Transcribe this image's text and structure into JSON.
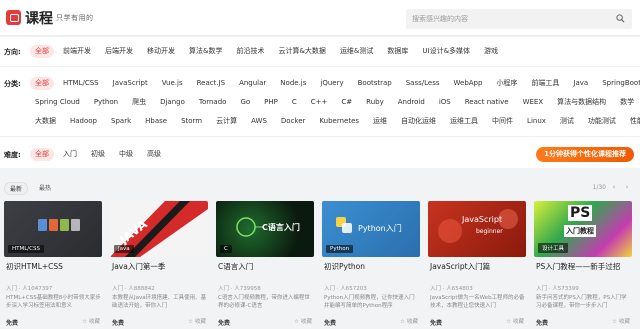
{
  "header": {
    "brand": "课程",
    "slogan": "只学有用的",
    "search_placeholder": "搜索感兴趣的内容"
  },
  "filters": {
    "direction": {
      "label": "方向:",
      "options": [
        "全部",
        "前端开发",
        "后端开发",
        "移动开发",
        "算法&数学",
        "前沿技术",
        "云计算&大数据",
        "运维&测试",
        "数据库",
        "UI设计&多媒体",
        "游戏"
      ]
    },
    "category": {
      "label": "分类:",
      "row1": [
        "全部",
        "HTML/CSS",
        "JavaScript",
        "Vue.js",
        "React.JS",
        "Angular",
        "Node.js",
        "jQuery",
        "Bootstrap",
        "Sass/Less",
        "WebApp",
        "小程序",
        "前端工具",
        "Java",
        "SpringBoot"
      ],
      "row2": [
        "Spring Cloud",
        "Python",
        "爬虫",
        "Django",
        "Tornado",
        "Go",
        "PHP",
        "C",
        "C++",
        "C#",
        "Ruby",
        "Android",
        "iOS",
        "React native",
        "WEEX",
        "算法与数据结构",
        "数学"
      ],
      "row3": [
        "大数据",
        "Hadoop",
        "Spark",
        "Hbase",
        "Storm",
        "云计算",
        "AWS",
        "Docker",
        "Kubernetes",
        "运维",
        "自动化运维",
        "运维工具",
        "中间件",
        "Linux",
        "测试",
        "功能测试",
        "性能测试"
      ]
    },
    "difficulty": {
      "label": "难度:",
      "options": [
        "全部",
        "入门",
        "初级",
        "中级",
        "高级"
      ]
    },
    "cta": "1分钟获得个性化课程推荐"
  },
  "sort": {
    "tabs": [
      "最新",
      "最热"
    ],
    "pager": "1/30",
    "prev": "‹",
    "next": "›"
  },
  "cards": [
    {
      "title": "初识HTML+CSS",
      "level": "入门",
      "learners": "人1047397",
      "desc": "HTML+CSS基础教程8小时带领大家步步深入学习标签用法和意义",
      "price": "免费",
      "fav": "收藏",
      "tag": "HTML/CSS",
      "thumb_text": ""
    },
    {
      "title": "Java入门第一季",
      "level": "入门",
      "learners": "人888842",
      "desc": "本教程从Java环境搭建、工具使用、基础语法开始，带你入门",
      "price": "免费",
      "fav": "收藏",
      "tag": "Java",
      "thumb_text": "JAVA"
    },
    {
      "title": "C语言入门",
      "level": "入门",
      "learners": "人739958",
      "desc": "C语言入门视频教程，带你进入编程世界的必修课-C语言",
      "price": "免费",
      "fav": "收藏",
      "tag": "C",
      "thumb_text": "C语言入门"
    },
    {
      "title": "初识Python",
      "level": "入门",
      "learners": "人657203",
      "desc": "Python入门视频教程，让你快速入门并能编写简单的Python程序",
      "price": "免费",
      "fav": "收藏",
      "tag": "Python",
      "thumb_text": "Python入门"
    },
    {
      "title": "JavaScript入门篇",
      "level": "入门",
      "learners": "人654803",
      "desc": "JavaScript做为一名Web工程师的必备技术，本教程让您快速入门",
      "price": "免费",
      "fav": "收藏",
      "tag": "",
      "thumb_text": "JavaScript",
      "thumb_sub": "beginner"
    },
    {
      "title": "PS入门教程——新手过招",
      "level": "入门",
      "learners": "人573399",
      "desc": "新手问答式的PS入门教程，PS入门学习必备课程，带你一步步入门",
      "price": "免费",
      "fav": "收藏",
      "tag": "设计工具",
      "thumb_text": "PS",
      "thumb_sub": "入门教程"
    }
  ],
  "colors": {
    "accent": "#e33c3c",
    "cta_start": "#ff7a1a",
    "cta_end": "#f05a00"
  }
}
